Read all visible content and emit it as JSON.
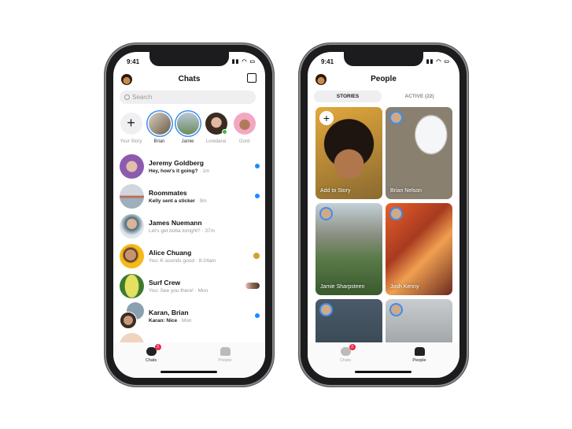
{
  "status": {
    "time": "9:41"
  },
  "chats_screen": {
    "title": "Chats",
    "search_placeholder": "Search",
    "stories": [
      {
        "label": "Your Story"
      },
      {
        "label": "Brian"
      },
      {
        "label": "Jamie"
      },
      {
        "label": "Loredana"
      },
      {
        "label": "Gord"
      }
    ],
    "conversations": [
      {
        "name": "Jeremy Goldberg",
        "preview": "Hey, how's it going?",
        "time": " · 1m",
        "unread": true
      },
      {
        "name": "Roommates",
        "preview": "Kelly sent a sticker",
        "time": " · 9m",
        "unread": true
      },
      {
        "name": "James Nuemann",
        "preview": "Let's get boba tonight?",
        "time": " · 37m",
        "unread": false
      },
      {
        "name": "Alice Chuang",
        "preview": "You: K sounds good",
        "time": " · 8:24am",
        "unread": false
      },
      {
        "name": "Surf Crew",
        "preview": "You: See you there!",
        "time": " · Mon",
        "unread": false
      },
      {
        "name": "Karan, Brian",
        "preview": "Karan: Nice",
        "time": " · Mon",
        "unread": true
      }
    ],
    "tabs": [
      {
        "label": "Chats",
        "badge": "3",
        "active": true
      },
      {
        "label": "People",
        "active": false
      }
    ]
  },
  "people_screen": {
    "title": "People",
    "segments": [
      {
        "label": "STORIES",
        "active": true
      },
      {
        "label": "ACTIVE (22)",
        "active": false
      }
    ],
    "stories": [
      {
        "label": "Add to Story"
      },
      {
        "label": "Brian Nelson"
      },
      {
        "label": "Jamie Sharpsteen"
      },
      {
        "label": "Josh Kenny"
      }
    ],
    "tabs": [
      {
        "label": "Chats",
        "badge": "3",
        "active": false
      },
      {
        "label": "People",
        "active": true
      }
    ]
  },
  "colors": {
    "accent": "#1a8cff",
    "badge": "#f0284a",
    "online": "#3cc13b"
  }
}
